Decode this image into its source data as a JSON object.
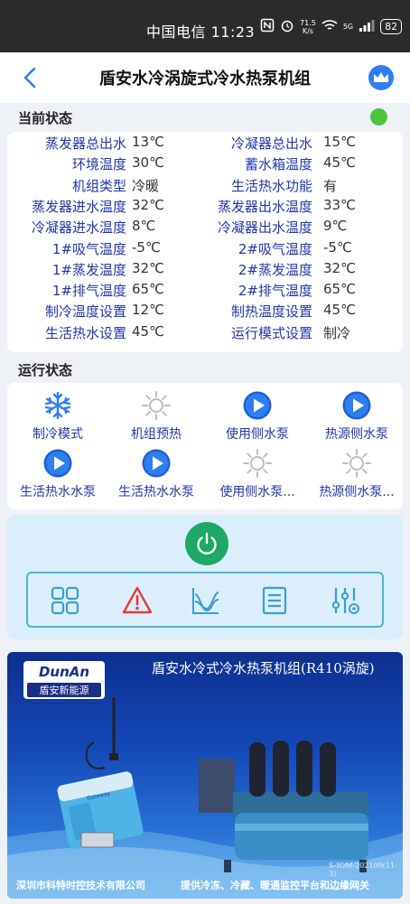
{
  "statusbar": {
    "carrier_time": "中国电信 11:23",
    "net_speed_value": "71.5",
    "net_speed_unit": "K/s",
    "signal_label": "5G",
    "battery": "82"
  },
  "header": {
    "title": "盾安水冷涡旋式冷水热泵机组"
  },
  "current_status": {
    "label": "当前状态",
    "indicator_color": "#4cc43c",
    "rows": [
      {
        "l1": "蒸发器总出水",
        "v1": "13℃",
        "l2": "冷凝器总出水",
        "v2": "15℃"
      },
      {
        "l1": "环境温度",
        "v1": "30℃",
        "l2": "蓄水箱温度",
        "v2": "45℃"
      },
      {
        "l1": "机组类型",
        "v1": "冷暖",
        "l2": "生活热水功能",
        "v2": "有"
      },
      {
        "l1": "蒸发器进水温度",
        "v1": "32℃",
        "l2": "蒸发器出水温度",
        "v2": "33℃"
      },
      {
        "l1": "冷凝器进水温度",
        "v1": "8℃",
        "l2": "冷凝器出水温度",
        "v2": "9℃"
      },
      {
        "l1": "1#吸气温度",
        "v1": "-5℃",
        "l2": "2#吸气温度",
        "v2": "-5℃"
      },
      {
        "l1": "1#蒸发温度",
        "v1": "32℃",
        "l2": "2#蒸发温度",
        "v2": "32℃"
      },
      {
        "l1": "1#排气温度",
        "v1": "65℃",
        "l2": "2#排气温度",
        "v2": "65℃"
      },
      {
        "l1": "制冷温度设置",
        "v1": "12℃",
        "l2": "制热温度设置",
        "v2": "45℃"
      },
      {
        "l1": "生活热水设置",
        "v1": "45℃",
        "l2": "运行模式设置",
        "v2": "制冷"
      }
    ]
  },
  "run_status": {
    "label": "运行状态",
    "items": [
      {
        "label": "制冷模式",
        "icon": "snowflake-icon"
      },
      {
        "label": "机组预热",
        "icon": "sun-icon"
      },
      {
        "label": "使用侧水泵",
        "icon": "play-icon"
      },
      {
        "label": "热源侧水泵",
        "icon": "play-icon"
      },
      {
        "label": "生活热水水泵",
        "icon": "play-icon"
      },
      {
        "label": "生活热水水泵",
        "icon": "play-icon"
      },
      {
        "label": "使用侧水泵...",
        "icon": "sun-icon"
      },
      {
        "label": "热源侧水泵...",
        "icon": "sun-icon"
      }
    ]
  },
  "controls": {
    "power_icon": "power-icon",
    "tools": [
      "grid-icon",
      "alert-icon",
      "chart-icon",
      "list-icon",
      "sliders-icon"
    ]
  },
  "banner": {
    "logo_en": "DunAn",
    "logo_cn": "盾安新能源",
    "title": "盾安水冷式冷水热泵机组(R410涡旋)",
    "device_label": "Gateway",
    "code": "S-IOM-202109(11-3)",
    "footer_left": "深圳市科特时控技术有限公司",
    "footer_right": "提供冷冻、冷藏、暖通监控平台和边缘网关"
  },
  "colors": {
    "label_blue": "#2236a8",
    "accent_blue": "#2d7ff0",
    "power_green": "#1ea868",
    "alert_red": "#e23a3a"
  }
}
